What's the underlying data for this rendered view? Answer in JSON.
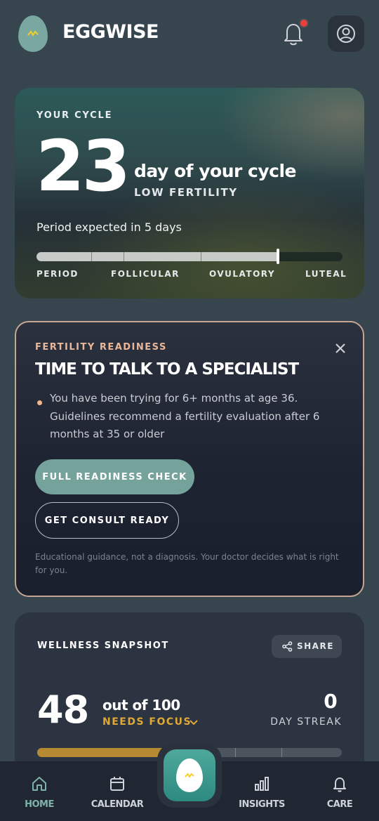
{
  "header": {
    "brand": "EGGWISE",
    "icons": {
      "logo": "egg-logo-icon",
      "bell": "bell-icon",
      "profile": "user-circle-icon"
    },
    "notification_dot_color": "#e8403c"
  },
  "cycle": {
    "label": "YOUR CYCLE",
    "day_number": "23",
    "day_text": "day of your cycle",
    "fertility": "LOW FERTILITY",
    "period_text": "Period expected in 5 days",
    "progress_fraction": 0.79,
    "phases": [
      "PERIOD",
      "FOLLICULAR",
      "OVULATORY",
      "LUTEAL"
    ]
  },
  "readiness": {
    "label": "FERTILITY READINESS",
    "title": "TIME TO TALK TO A SPECIALIST",
    "bullet": "You have been trying for 6+ months at age 36. Guidelines recommend a fertility evaluation after 6 months at 35 or older",
    "primary_button": "FULL READINESS CHECK",
    "secondary_button": "GET CONSULT READY",
    "disclaimer": "Educational guidance, not a diagnosis. Your doctor decides what is right for you.",
    "accent_color": "#e9b79a"
  },
  "wellness": {
    "label": "WELLNESS SNAPSHOT",
    "share_label": "SHARE",
    "score": "48",
    "out_of": "out of 100",
    "status": "NEEDS FOCUS",
    "streak_number": "0",
    "streak_label": "DAY STREAK",
    "score_fraction": 0.48,
    "status_color": "#e0a835"
  },
  "nav": {
    "items": [
      {
        "label": "HOME",
        "icon": "home-icon"
      },
      {
        "label": "CALENDAR",
        "icon": "calendar-icon"
      },
      {
        "label": "INSIGHTS",
        "icon": "bar-chart-icon"
      },
      {
        "label": "CARE",
        "icon": "bell-icon"
      }
    ],
    "center_icon": "egg-logo-icon",
    "active_color": "#7fb1aa"
  }
}
